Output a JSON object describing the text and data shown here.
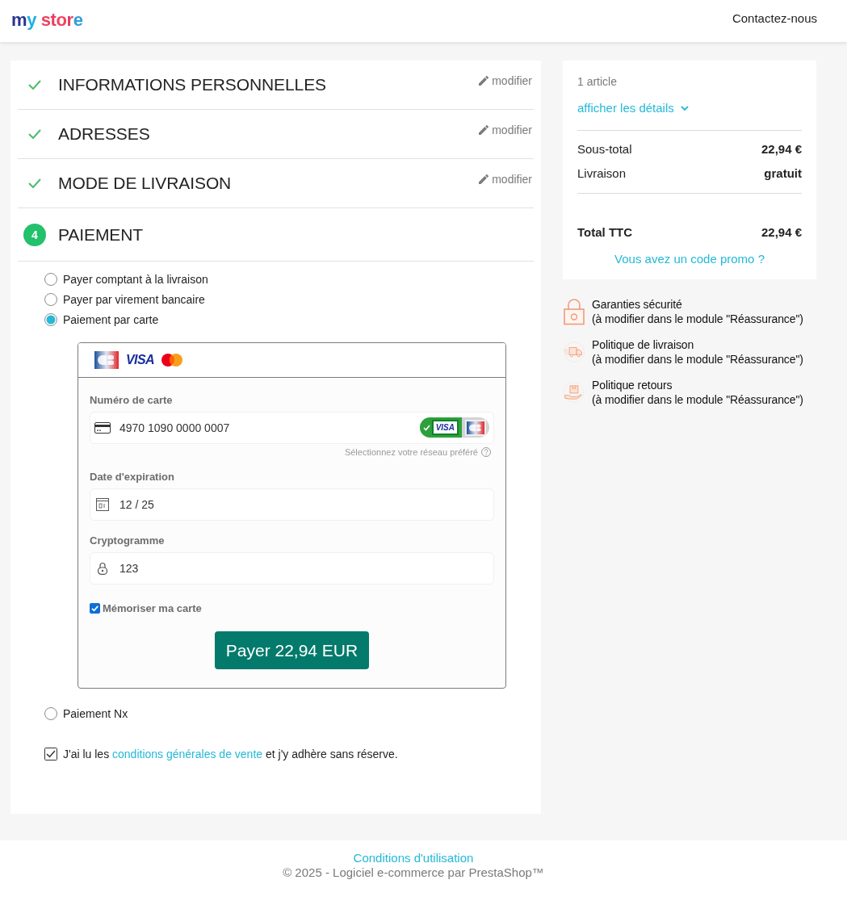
{
  "header": {
    "logo": "my store",
    "contact_link": "Contactez-nous"
  },
  "steps": [
    {
      "title": "INFORMATIONS PERSONNELLES",
      "complete": true,
      "edit_link": "modifier"
    },
    {
      "title": "ADRESSES",
      "complete": true,
      "edit_link": "modifier"
    },
    {
      "title": "MODE DE LIVRAISON",
      "complete": true,
      "edit_link": "modifier"
    },
    {
      "number": "4",
      "title": "PAIEMENT",
      "complete": false
    }
  ],
  "payment_options": [
    {
      "label": "Payer comptant à la livraison",
      "selected": false
    },
    {
      "label": "Payer par virement bancaire",
      "selected": false
    },
    {
      "label": "Paiement par carte",
      "selected": true,
      "card_form": {
        "brands": [
          {
            "kind": "cb"
          },
          {
            "kind": "visa",
            "label": "VISA"
          },
          {
            "kind": "mastercard"
          }
        ],
        "fields": [
          {
            "kind": "card_number",
            "label": "Numéro de carte",
            "value": "4970 1090 0000 0007"
          },
          {
            "kind": "expiry",
            "label": "Date d'expiration",
            "value": "12 / 25"
          },
          {
            "kind": "cvc",
            "label": "Cryptogramme",
            "value": "123"
          }
        ],
        "networks": [
          {
            "kind": "visa",
            "label": "VISA",
            "selected": true
          },
          {
            "kind": "cb",
            "selected": false
          }
        ],
        "network_hint": "Sélectionnez votre réseau préféré",
        "remember": {
          "label": "Mémoriser ma carte",
          "checked": true
        },
        "pay_button": "Payer 22,94 EUR"
      }
    },
    {
      "label": "Paiement Nx",
      "selected": false
    }
  ],
  "terms": {
    "checked": true,
    "before": "J'ai lu les ",
    "link": "conditions générales de vente",
    "after": " et j'y adhère sans réserve."
  },
  "summary": {
    "item_count": "1 article",
    "details_link": "afficher les détails",
    "lines": [
      {
        "label": "Sous-total",
        "value": "22,94 €"
      },
      {
        "label": "Livraison",
        "value": "gratuit"
      }
    ],
    "total": {
      "label": "Total TTC",
      "value": "22,94 €"
    },
    "promo_link": "Vous avez un code promo ?"
  },
  "reassurance": [
    {
      "kind": "security",
      "title": "Garanties sécurité",
      "note": "(à modifier dans le module \"Réassurance\")"
    },
    {
      "kind": "delivery",
      "title": "Politique de livraison",
      "note": "(à modifier dans le module \"Réassurance\")"
    },
    {
      "kind": "returns",
      "title": "Politique retours",
      "note": "(à modifier dans le module \"Réassurance\")"
    }
  ],
  "footer": {
    "link": "Conditions d'utilisation",
    "copyright": "© 2025 - Logiciel e-commerce par PrestaShop™"
  }
}
